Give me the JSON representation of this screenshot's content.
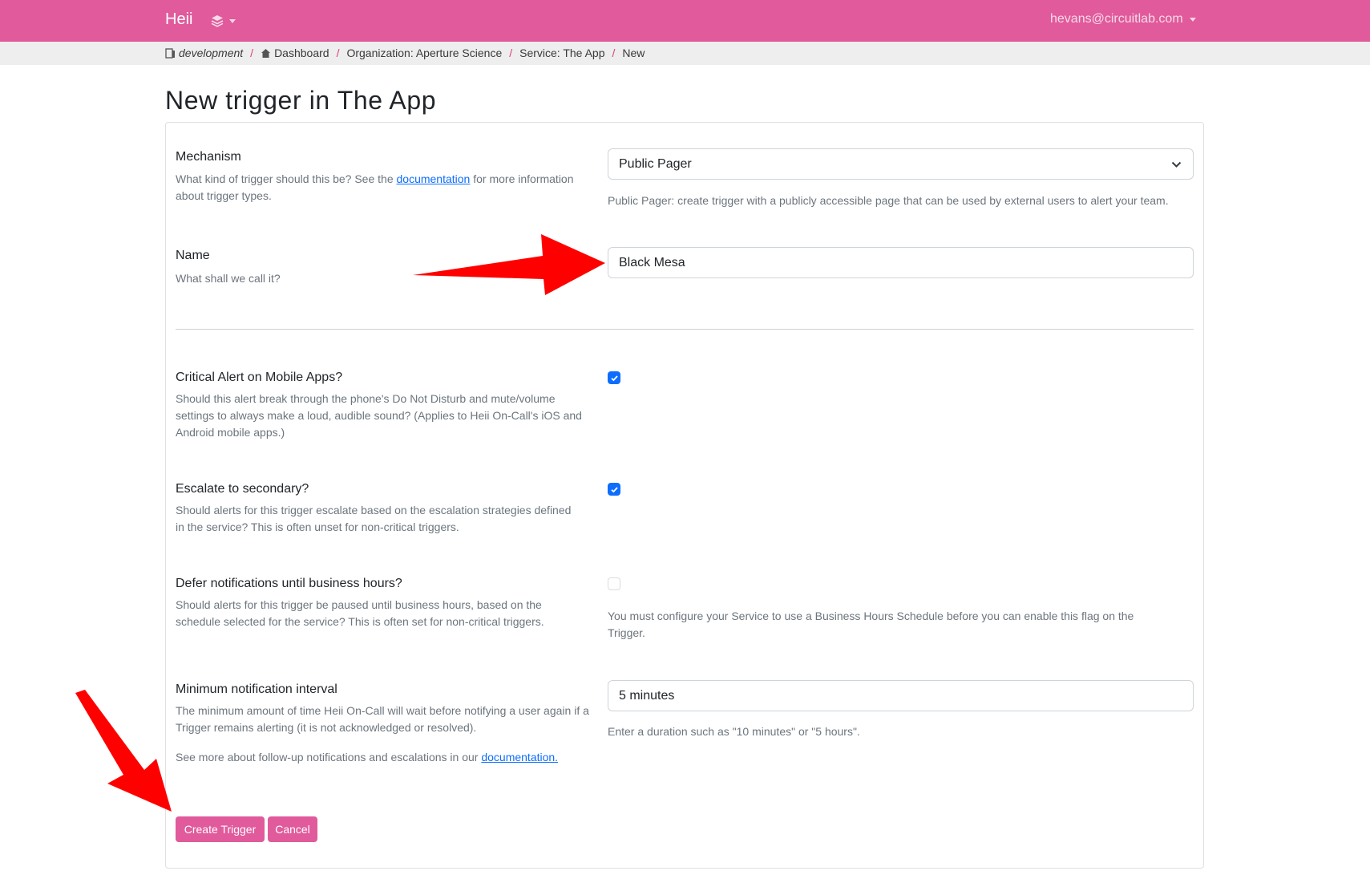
{
  "navbar": {
    "brand": "Heii",
    "user_email": "hevans@circuitlab.com",
    "background": "#e05a9c"
  },
  "breadcrumb": [
    {
      "label": "development",
      "icon": "server-icon"
    },
    {
      "label": "Dashboard",
      "icon": "home-icon"
    },
    {
      "label": "Organization: Aperture Science"
    },
    {
      "label": "Service: The App"
    },
    {
      "label": "New"
    }
  ],
  "page": {
    "title": "New trigger in The App"
  },
  "form": {
    "mechanism": {
      "label": "Mechanism",
      "help_before": "What kind of trigger should this be? See the ",
      "help_link": "documentation",
      "help_after": " for more information about trigger types.",
      "value": "Public Pager",
      "note": "Public Pager: create trigger with a publicly accessible page that can be used by external users to alert your team."
    },
    "name": {
      "label": "Name",
      "help": "What shall we call it?",
      "value": "Black Mesa"
    },
    "critical_alert": {
      "label": "Critical Alert on Mobile Apps?",
      "help": "Should this alert break through the phone's Do Not Disturb and mute/volume settings to always make a loud, audible sound? (Applies to Heii On-Call's iOS and Android mobile apps.)",
      "checked": true
    },
    "escalate": {
      "label": "Escalate to secondary?",
      "help": "Should alerts for this trigger escalate based on the escalation strategies defined in the service? This is often unset for non-critical triggers.",
      "checked": true
    },
    "defer": {
      "label": "Defer notifications until business hours?",
      "help": "Should alerts for this trigger be paused until business hours, based on the schedule selected for the service? This is often set for non-critical triggers.",
      "checked": false,
      "note": "You must configure your Service to use a Business Hours Schedule before you can enable this flag on the Trigger."
    },
    "min_interval": {
      "label": "Minimum notification interval",
      "help": "The minimum amount of time Heii On-Call will wait before notifying a user again if a Trigger remains alerting (it is not acknowledged or resolved).",
      "help2_before": "See more about follow-up notifications and escalations in our ",
      "help2_link": "documentation.",
      "value": "5 minutes",
      "note": "Enter a duration such as \"10 minutes\" or \"5 hours\"."
    },
    "buttons": {
      "create": "Create Trigger",
      "cancel": "Cancel"
    }
  },
  "colors": {
    "accent": "#e05a9c",
    "checkbox": "#0d6efd",
    "annotation_arrow": "#ff0000"
  }
}
